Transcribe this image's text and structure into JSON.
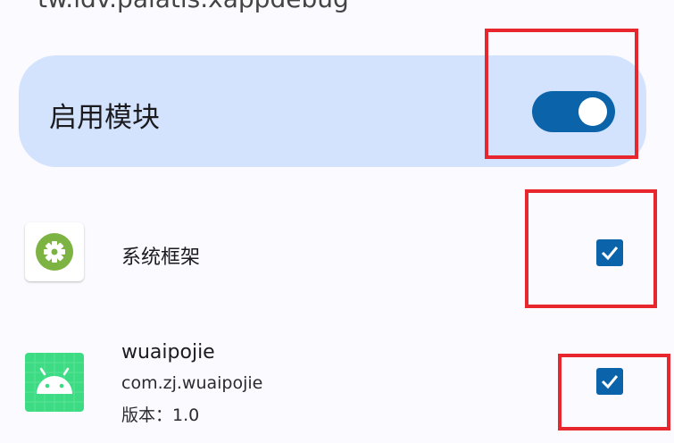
{
  "header": {
    "package_name": "tw.idv.palatis.xappdebug"
  },
  "enable_module": {
    "label": "启用模块",
    "enabled": true
  },
  "scope_list": [
    {
      "title": "系统框架",
      "icon": "gear-icon",
      "checked": true
    },
    {
      "title": "wuaipojie",
      "package": "com.zj.wuaipojie",
      "version": "版本：1.0",
      "icon": "android-icon",
      "checked": true
    }
  ],
  "colors": {
    "accent": "#0b63a9",
    "card_background": "#d3e3fd",
    "highlight": "#e8262d",
    "gear_icon_bg": "#7cb342",
    "android_icon_bg": "#3ddc84"
  }
}
